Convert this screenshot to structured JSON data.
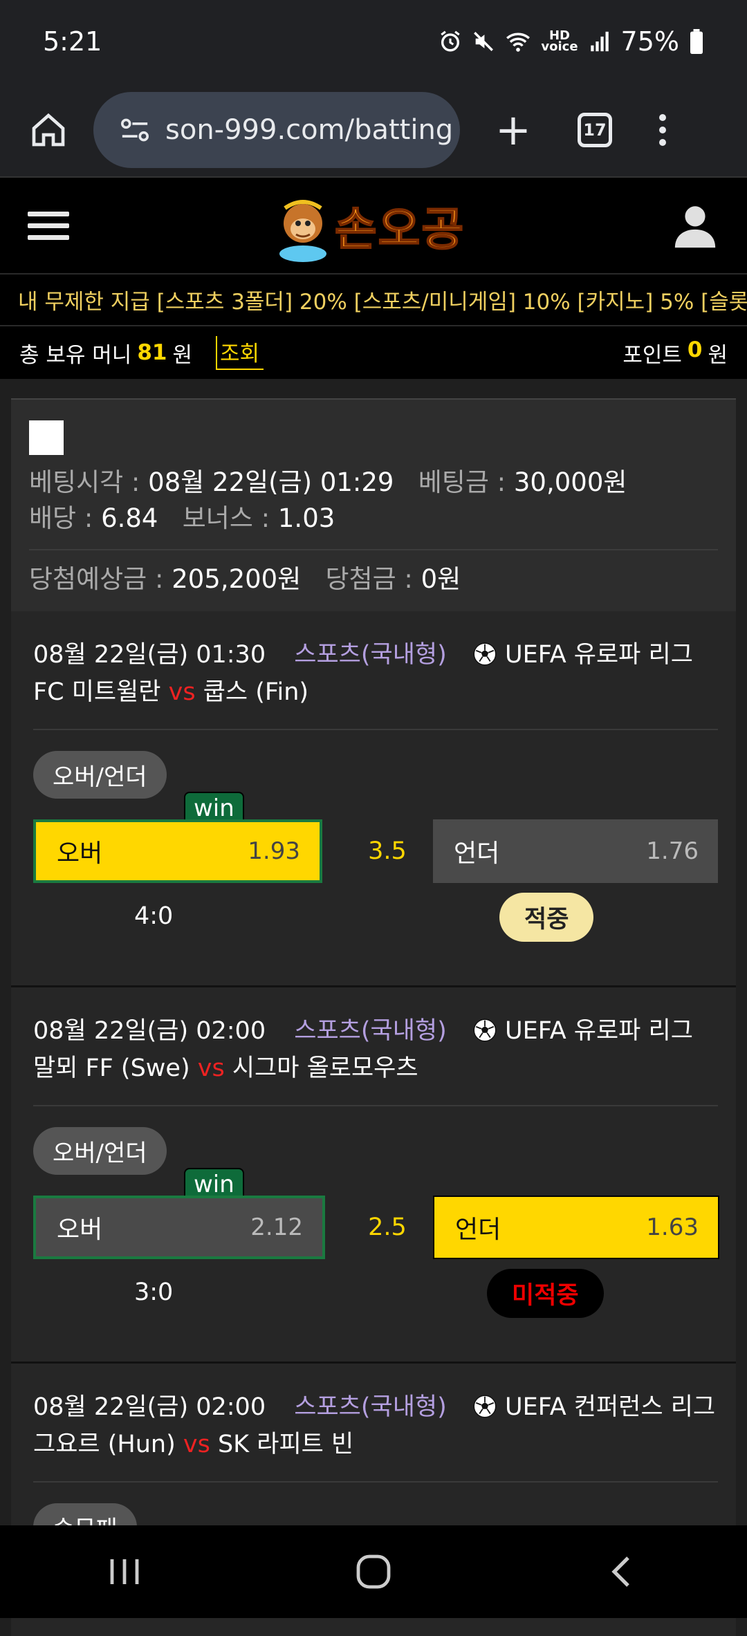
{
  "status": {
    "time": "5:21",
    "battery": "75%"
  },
  "browser": {
    "url": "son-999.com/batting",
    "tab_count": "17"
  },
  "site": {
    "logo_text": "손오공",
    "ticker": "내 무제한 지급 [스포츠 3폴더] 20% [스포츠/미니게임] 10% [카지노] 5% [슬롯]",
    "balance_label": "총 보유 머니",
    "balance_value": "81",
    "balance_unit": "원",
    "inquire_label": "조회",
    "points_label": "포인트",
    "points_value": "0",
    "points_unit": "원"
  },
  "summary": {
    "bet_time_label": "베팅시각 :",
    "bet_time_value": "08월 22일(금) 01:29",
    "bet_amount_label": "베팅금 :",
    "bet_amount_value": "30,000원",
    "odds_label": "배당 :",
    "odds_value": "6.84",
    "bonus_label": "보너스 :",
    "bonus_value": "1.03",
    "expected_label": "당첨예상금 :",
    "expected_value": "205,200원",
    "won_label": "당첨금 :",
    "won_value": "0원"
  },
  "matches": [
    {
      "datetime": "08월 22일(금) 01:30",
      "category": "스포츠(국내형)",
      "league": "UEFA 유로파 리그",
      "home": "FC 미트윌란",
      "vs": "vs",
      "away": "쿱스 (Fin)",
      "market": "오버/언더",
      "over_label": "오버",
      "over_odds": "1.93",
      "line": "3.5",
      "under_label": "언더",
      "under_odds": "1.76",
      "win_badge": "win",
      "score": "4:0",
      "result": "적중"
    },
    {
      "datetime": "08월 22일(금) 02:00",
      "category": "스포츠(국내형)",
      "league": "UEFA 유로파 리그",
      "home": "말뫼 FF (Swe)",
      "vs": "vs",
      "away": "시그마 올로모우츠",
      "market": "오버/언더",
      "over_label": "오버",
      "over_odds": "2.12",
      "line": "2.5",
      "under_label": "언더",
      "under_odds": "1.63",
      "win_badge": "win",
      "score": "3:0",
      "result": "미적중"
    },
    {
      "datetime": "08월 22일(금) 02:00",
      "category": "스포츠(국내형)",
      "league": "UEFA 컨퍼런스 리그",
      "home": "그요르 (Hun)",
      "vs": "vs",
      "away": "SK 라피트 빈",
      "market": "승무패"
    }
  ]
}
